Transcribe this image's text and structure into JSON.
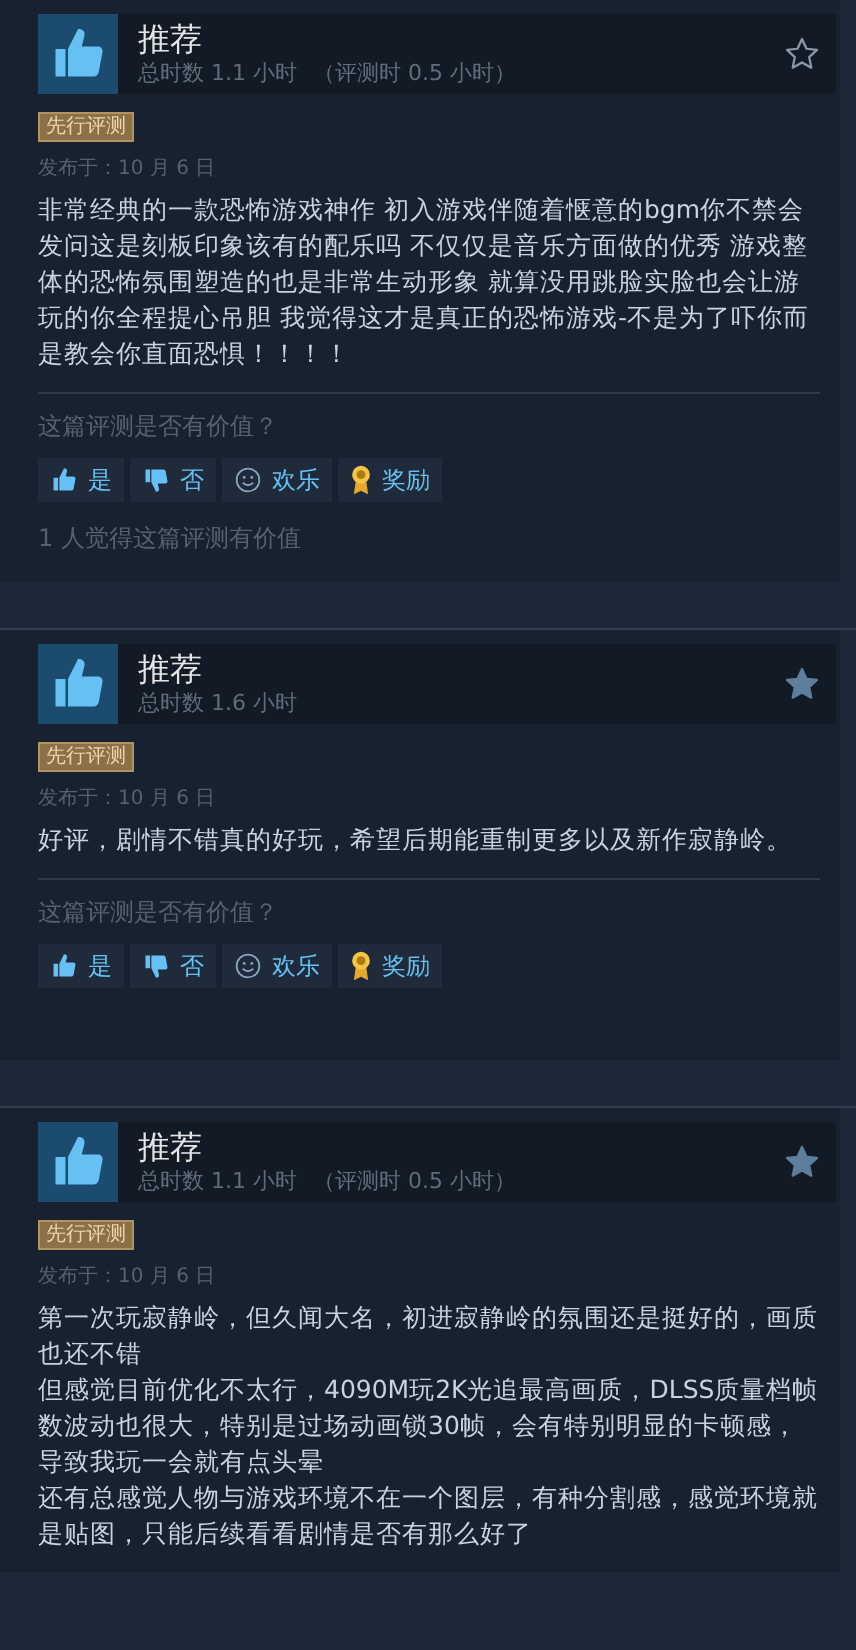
{
  "reviews": [
    {
      "verdict": "推荐",
      "hours": "总时数 1.1 小时",
      "review_hours": "（评测时 0.5 小时）",
      "starred": false,
      "early_access": "先行评测",
      "posted": "发布于：10 月 6 日",
      "paragraphs": [
        "非常经典的一款恐怖游戏神作 初入游戏伴随着惬意的bgm你不禁会发问这是刻板印象该有的配乐吗 不仅仅是音乐方面做的优秀 游戏整体的恐怖氛围塑造的也是非常生动形象 就算没用跳脸实脸也会让游玩的你全程提心吊胆 我觉得这才是真正的恐怖游戏-不是为了吓你而是教会你直面恐惧！！！！"
      ],
      "helpful_prompt": "这篇评测是否有价值？",
      "buttons": [
        {
          "kind": "yes",
          "label": "是"
        },
        {
          "kind": "no",
          "label": "否"
        },
        {
          "kind": "funny",
          "label": "欢乐"
        },
        {
          "kind": "award",
          "label": "奖励"
        }
      ],
      "helpful_count": "1 人觉得这篇评测有价值"
    },
    {
      "verdict": "推荐",
      "hours": "总时数 1.6 小时",
      "starred": true,
      "early_access": "先行评测",
      "posted": "发布于：10 月 6 日",
      "paragraphs": [
        "好评，剧情不错真的好玩，希望后期能重制更多以及新作寂静岭。"
      ],
      "helpful_prompt": "这篇评测是否有价值？",
      "buttons": [
        {
          "kind": "yes",
          "label": "是"
        },
        {
          "kind": "no",
          "label": "否"
        },
        {
          "kind": "funny",
          "label": "欢乐"
        },
        {
          "kind": "award",
          "label": "奖励"
        }
      ]
    },
    {
      "verdict": "推荐",
      "hours": "总时数 1.1 小时",
      "review_hours": "（评测时 0.5 小时）",
      "starred": true,
      "early_access": "先行评测",
      "posted": "发布于：10 月 6 日",
      "paragraphs": [
        "第一次玩寂静岭，但久闻大名，初进寂静岭的氛围还是挺好的，画质也还不错",
        "但感觉目前优化不太行，4090M玩2K光追最高画质，DLSS质量档帧数波动也很大，特别是过场动画锁30帧，会有特别明显的卡顿感，导致我玩一会就有点头晕",
        "还有总感觉人物与游戏环境不在一个图层，有种分割感，感觉环境就是贴图，只能后续看看剧情是否有那么好了"
      ]
    }
  ]
}
